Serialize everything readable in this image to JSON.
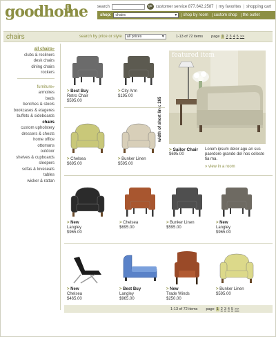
{
  "header": {
    "logo": "goodhome",
    "logo_suffix": ".com",
    "search_label": "search",
    "go_label": "go",
    "customer_service": "customer service 877.642.2587",
    "sep": "|",
    "favorites": "my favorites",
    "cart": "shopping cart",
    "shop_label": "shop:",
    "shop_value": "chairs",
    "nav": [
      "shop by room",
      "custom shop",
      "the outlet"
    ]
  },
  "titlebar": {
    "title": "chairs",
    "search_by": "search by price or style",
    "price_value": "all prices",
    "count": "1-13 of 72 items",
    "page_label": "page",
    "pages": [
      "1",
      "2",
      "3",
      "4",
      "5",
      ">>"
    ]
  },
  "sidebar": {
    "groups": [
      {
        "head": "all chairs",
        "head_arrow": "»",
        "items": [
          "clubs & recliners",
          "desk chairs",
          "dining chairs",
          "rockers"
        ]
      },
      {
        "head": "furniture",
        "head_arrow": "»",
        "items": [
          "armoires",
          "beds",
          "benches & stools",
          "bookcases & etageres",
          "buffets & sideboards",
          "chairs",
          "custom upholstery",
          "dressers & chests",
          "home office",
          "ottomans",
          "outdoor",
          "shelves & cupboards",
          "sleepers",
          "sofas & loveseats",
          "tables",
          "wicker & rattan"
        ]
      }
    ],
    "active": "chairs"
  },
  "products": [
    {
      "badge": "Best Buy",
      "name": "Retro Chair",
      "price": "$595.00",
      "color": "#6b6b6b",
      "kind": "chair"
    },
    {
      "badge": "",
      "name": "City Arm",
      "price": "$195.00",
      "color": "#5c5a50",
      "kind": "chair"
    },
    {
      "badge": "",
      "name": "Chelsea",
      "price": "$695.00",
      "color": "#c9c879",
      "kind": "club"
    },
    {
      "badge": "",
      "name": "Bunker Linen",
      "price": "$595.00",
      "color": "#d8cfb9",
      "kind": "club"
    },
    {
      "badge": "New",
      "name": "Langley",
      "price": "$965.00",
      "color": "#2b2b2b",
      "kind": "club"
    },
    {
      "badge": "",
      "name": "Chelsea",
      "price": "$695.00",
      "color": "#a8562f",
      "kind": "chair"
    },
    {
      "badge": "",
      "name": "Bunker Linen",
      "price": "$595.00",
      "color": "#4f4f4f",
      "kind": "chair"
    },
    {
      "badge": "New",
      "name": "Langley",
      "price": "$965.00",
      "color": "#6e6a62",
      "kind": "chair"
    },
    {
      "badge": "New",
      "name": "Chelsea",
      "price": "$465.00",
      "color": "#1c1c1c",
      "kind": "lounger"
    },
    {
      "badge": "Best Buy",
      "name": "Langley",
      "price": "$965.00",
      "color": "#5a82c8",
      "kind": "chaise"
    },
    {
      "badge": "New",
      "name": "Trade Winds",
      "price": "$250.00",
      "color": "#9a4a28",
      "kind": "tall"
    },
    {
      "badge": "",
      "name": "Bunker Linen",
      "price": "$595.00",
      "color": "#dcd98a",
      "kind": "club"
    }
  ],
  "featured": {
    "label": "featured item",
    "vertical_text": "width of short line: 265",
    "name": "Sailor Chair",
    "price": "$695.00",
    "desc": "Lorem ipsum delor agu an sus paerdore grande del nos celeste tia ma.",
    "view": "» view in a room"
  },
  "bottom": {
    "count": "1-13 of 72 items",
    "page_label": "page",
    "pages": [
      "1",
      "2",
      "3",
      "4",
      "5",
      ">>"
    ]
  },
  "colors": {
    "accent": "#8c8f44",
    "bar": "#e8e8d6"
  }
}
